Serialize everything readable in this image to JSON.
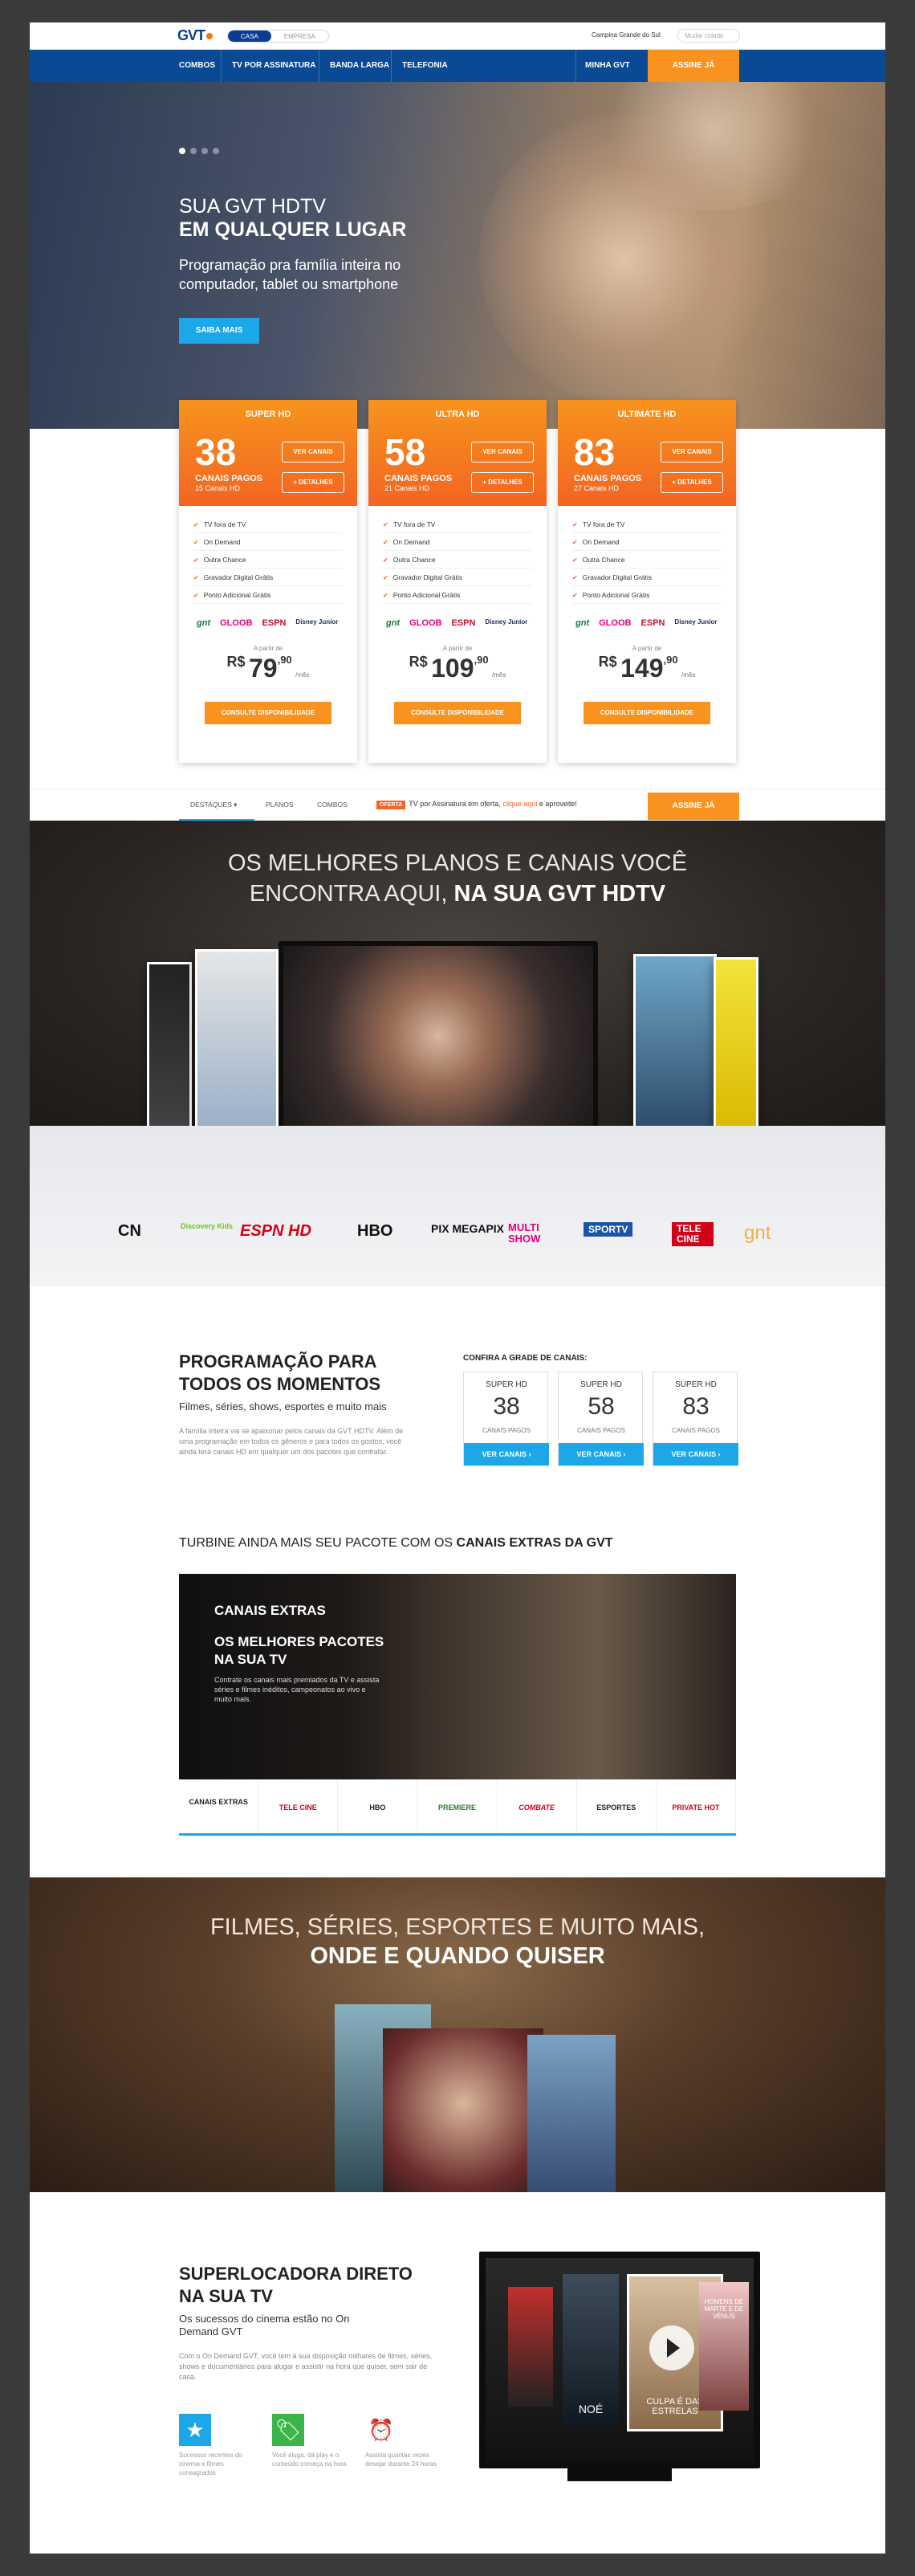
{
  "topbar": {
    "logo": "GVT",
    "seg_casa": "CASA",
    "seg_empresa": "EMPRESA",
    "region": "Campina Grande do Sul",
    "search_placeholder": "Mudar cidade"
  },
  "nav": {
    "items": [
      "COMBOS",
      "TV POR ASSINATURA",
      "BANDA LARGA",
      "TELEFONIA"
    ],
    "minha": "MINHA GVT",
    "cta": "ASSINE JÁ"
  },
  "hero": {
    "line1": "SUA GVT HDTV",
    "line2": "EM QUALQUER LUGAR",
    "body": "Programação pra família inteira no computador, tablet ou smartphone",
    "button": "SAIBA MAIS"
  },
  "plans": [
    {
      "name": "SUPER HD",
      "count": "38",
      "label": "CANAIS PAGOS",
      "hd": "15 Canais HD",
      "btn1": "VER CANAIS",
      "btn2": "+ DETALHES",
      "features": [
        "TV fora de TV",
        "On Demand",
        "Outra Chance",
        "Gravador Digital Grátis",
        "Ponto Adicional Grátis"
      ],
      "from": "A partir de",
      "currency": "R$",
      "price": "79",
      "cents": ",90",
      "per": "/mês",
      "cta": "CONSULTE DISPONIBILIDADE"
    },
    {
      "name": "ULTRA HD",
      "count": "58",
      "label": "CANAIS PAGOS",
      "hd": "21 Canais HD",
      "btn1": "VER CANAIS",
      "btn2": "+ DETALHES",
      "features": [
        "TV fora de TV",
        "On Demand",
        "Outra Chance",
        "Gravador Digital Grátis",
        "Ponto Adicional Grátis"
      ],
      "from": "A partir de",
      "currency": "R$",
      "price": "109",
      "cents": ",90",
      "per": "/mês",
      "cta": "CONSULTE DISPONIBILIDADE"
    },
    {
      "name": "ULTIMATE HD",
      "count": "83",
      "label": "CANAIS PAGOS",
      "hd": "27 Canais HD",
      "btn1": "VER CANAIS",
      "btn2": "+ DETALHES",
      "features": [
        "TV fora de TV",
        "On Demand",
        "Outra Chance",
        "Gravador Digital Grátis",
        "Ponto Adicional Grátis"
      ],
      "from": "A partir de",
      "currency": "R$",
      "price": "149",
      "cents": ",90",
      "per": "/mês",
      "cta": "CONSULTE DISPONIBILIDADE"
    }
  ],
  "plan_channels": [
    "gnt",
    "GLOOB",
    "ESPN",
    "Disney Junior"
  ],
  "subbar": {
    "destaques": "DESTAQUES ▾",
    "planos": "PLANOS",
    "combos": "COMBOS",
    "promo_tag": "OFERTA",
    "promo_text": "TV por Assinatura em oferta, ",
    "promo_link": "clique aqui",
    "promo_end": " e aproveite!",
    "cta": "ASSINE JÁ"
  },
  "showcase": {
    "line1": "OS MELHORES PLANOS E CANAIS VOCÊ",
    "line2a": "ENCONTRA AQUI, ",
    "line2b": "NA SUA GVT HDTV"
  },
  "channel_logos": [
    "CN",
    "Discovery Kids",
    "ESPN HD",
    "HBO",
    "PIX MEGAPIX",
    "MULTI SHOW",
    "SPORTV",
    "TELE CINE",
    "gnt"
  ],
  "programming": {
    "title": "PROGRAMAÇÃO PARA TODOS OS MOMENTOS",
    "sub": "Filmes, séries, shows, esportes e muito mais",
    "desc": "A família inteira vai se apaixonar pelos canais da GVT HDTV. Além de uma programação em todos os gêneros e para todos os gostos, você ainda terá canais HD em qualquer um dos pacotes que contratar.",
    "confira": "CONFIRA A GRADE DE CANAIS:",
    "boxes": [
      {
        "name": "SUPER HD",
        "value": "38",
        "cap": "CANAIS PAGOS",
        "btn": "VER CANAIS ›"
      },
      {
        "name": "SUPER HD",
        "value": "58",
        "cap": "CANAIS PAGOS",
        "btn": "VER CANAIS ›"
      },
      {
        "name": "SUPER HD",
        "value": "83",
        "cap": "CANAIS PAGOS",
        "btn": "VER CANAIS ›"
      }
    ]
  },
  "extras": {
    "heading_a": "TURBINE AINDA MAIS SEU PACOTE COM OS ",
    "heading_b": "CANAIS EXTRAS DA GVT",
    "kicker": "CANAIS EXTRAS",
    "headline": "OS MELHORES PACOTES NA SUA TV",
    "desc": "Contrate os canais mais premiados da TV e assista séries e filmes inéditos, campeonatos ao vivo e muito mais.",
    "tabs": [
      "CANAIS EXTRAS",
      "TELE CINE",
      "HBO",
      "PREMIERE",
      "COMBATE",
      "ESPORTES",
      "PRIVATE HOT"
    ]
  },
  "movies": {
    "line1": "FILMES, SÉRIES, ESPORTES E MUITO MAIS,",
    "line2": "ONDE E QUANDO QUISER"
  },
  "superlocadora": {
    "title": "SUPERLOCADORA DIRETO NA SUA TV",
    "sub": "Os sucessos do cinema estão no On Demand GVT",
    "desc": "Com o On Demand GVT, você tem à sua disposição milhares de filmes, séries, shows e documentários para alugar e assistir na hora que quiser, sem sair de casa.",
    "features": [
      {
        "icon": "★",
        "text": "Sucessos recentes do cinema e filmes consagrados"
      },
      {
        "icon": "🏷",
        "text": "Você aluga, dá play e o conteúdo começa na hora"
      },
      {
        "icon": "⏰",
        "text": "Assista quantas vezes desejar durante 24 horas"
      }
    ],
    "posters": [
      "NOÉ",
      "CULPA É DAS ESTRELAS",
      "HOMENS DE MARTE E DE VÊNUS"
    ]
  },
  "colors": {
    "brand_blue": "#0a4a94",
    "orange": "#f7931e",
    "cyan": "#1ba7e8"
  }
}
